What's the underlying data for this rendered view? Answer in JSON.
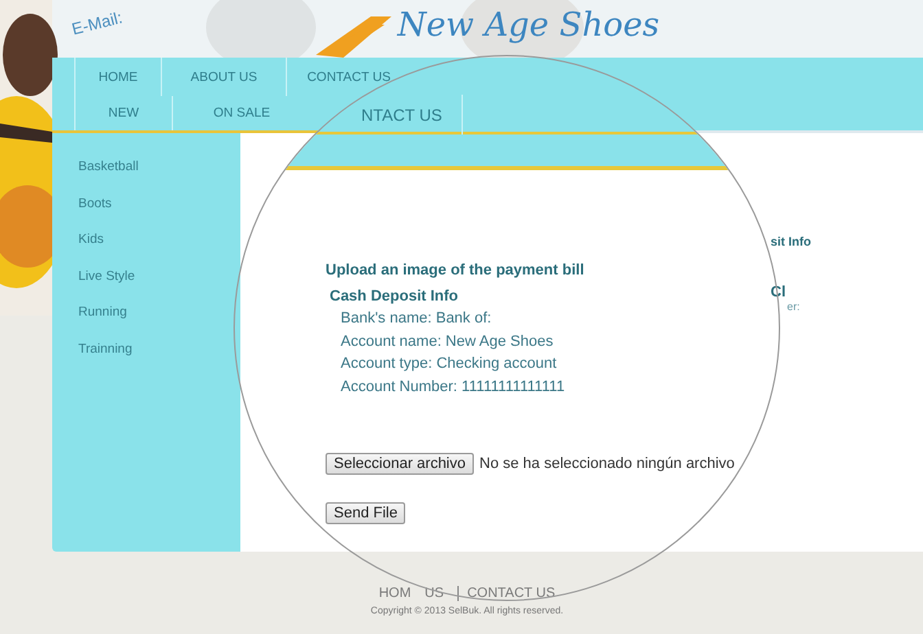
{
  "header": {
    "email": "E-Mail:",
    "logo": "New Age Shoes"
  },
  "nav_primary": [
    {
      "label": "HOME"
    },
    {
      "label": "ABOUT US"
    },
    {
      "label": "CONTACT US"
    }
  ],
  "nav_secondary": [
    {
      "label": "NEW"
    },
    {
      "label": "ON SALE"
    }
  ],
  "lens": {
    "nav_label": "NTACT US"
  },
  "sidebar": {
    "items": [
      "Basketball",
      "Boots",
      "Kids",
      "Live Style",
      "Running",
      "Trainning"
    ]
  },
  "content": {
    "title": "Upload an image of the payment bill",
    "section": "Cash Deposit Info",
    "lines": [
      "Bank's name: Bank of:",
      "Account name: New Age Shoes",
      "Account type: Checking account",
      "Account Number: 11111111111111"
    ],
    "file_button": "Seleccionar archivo",
    "file_status": "No se ha seleccionado ningún archivo",
    "send_button": "Send File"
  },
  "right_column": {
    "heading": "sit Info",
    "subheading": "Cl",
    "label": "er:"
  },
  "footer": {
    "links": [
      "HOM",
      "US",
      "CONTACT US"
    ],
    "copyright": "Copyright © 2013 SelBuk. All rights reserved."
  }
}
